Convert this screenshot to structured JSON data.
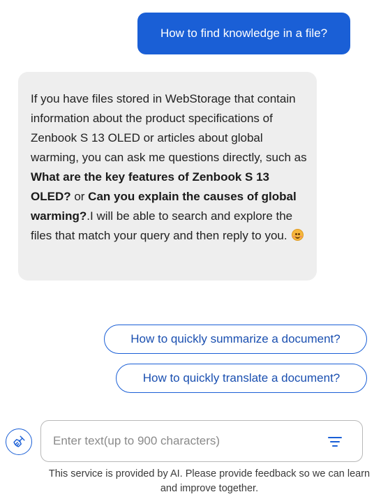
{
  "user_message": {
    "text": "How to find knowledge in a file?"
  },
  "ai_message": {
    "part1": "If you have files stored in WebStorage that contain information about the product specifications of Zenbook S 13 OLED or articles about global warming, you can ask me questions directly, such as ",
    "bold1": "What are the key features of Zenbook S 13 OLED?",
    "part2": " or ",
    "bold2": "Can you explain the causes of global warming?",
    "part3": ".I will be able to search and explore the files that match your query and then reply to you.",
    "emoji": "smiling-face-icon"
  },
  "suggestions": [
    {
      "label": "How to quickly summarize a document?"
    },
    {
      "label": "How to quickly translate a document?"
    }
  ],
  "input": {
    "placeholder": "Enter text(up to 900 characters)",
    "value": ""
  },
  "icons": {
    "clear": "brush-icon",
    "options": "filter-icon"
  },
  "footer": {
    "note": "This service is provided by AI. Please provide feedback so we can learn and improve together."
  },
  "colors": {
    "accent": "#1a5fd6",
    "bubble_bg": "#eeeeee",
    "accent_text": "#1a4fb0"
  }
}
